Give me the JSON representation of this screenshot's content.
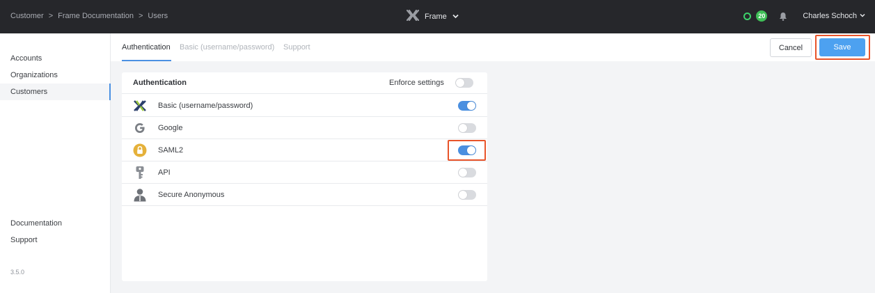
{
  "topbar": {
    "breadcrumb": [
      "Customer",
      "Frame Documentation",
      "Users"
    ],
    "breadcrumb_separator": ">",
    "brand": "Frame",
    "notification_count": "20",
    "user_name": "Charles Schoch"
  },
  "sidebar": {
    "items": [
      {
        "label": "Accounts",
        "active": false
      },
      {
        "label": "Organizations",
        "active": false
      },
      {
        "label": "Customers",
        "active": true
      }
    ],
    "footer_items": [
      {
        "label": "Documentation"
      },
      {
        "label": "Support"
      }
    ],
    "version": "3.5.0"
  },
  "tabs": [
    {
      "label": "Authentication",
      "active": true
    },
    {
      "label": "Basic (username/password)",
      "active": false
    },
    {
      "label": "Support",
      "active": false
    }
  ],
  "actions": {
    "cancel_label": "Cancel",
    "save_label": "Save"
  },
  "card": {
    "title": "Authentication",
    "enforce_label": "Enforce settings",
    "enforce_enabled": false,
    "providers": [
      {
        "label": "Basic (username/password)",
        "icon": "frame-x-logo-icon",
        "enabled": true
      },
      {
        "label": "Google",
        "icon": "google-g-icon",
        "enabled": false
      },
      {
        "label": "SAML2",
        "icon": "padlock-icon",
        "enabled": true
      },
      {
        "label": "API",
        "icon": "key-icon",
        "enabled": false
      },
      {
        "label": "Secure Anonymous",
        "icon": "anonymous-user-icon",
        "enabled": false
      }
    ]
  },
  "colors": {
    "accent": "#4a90e2",
    "highlight": "#e8542a",
    "topbar": "#26272b",
    "status_green": "#3fbf57"
  }
}
